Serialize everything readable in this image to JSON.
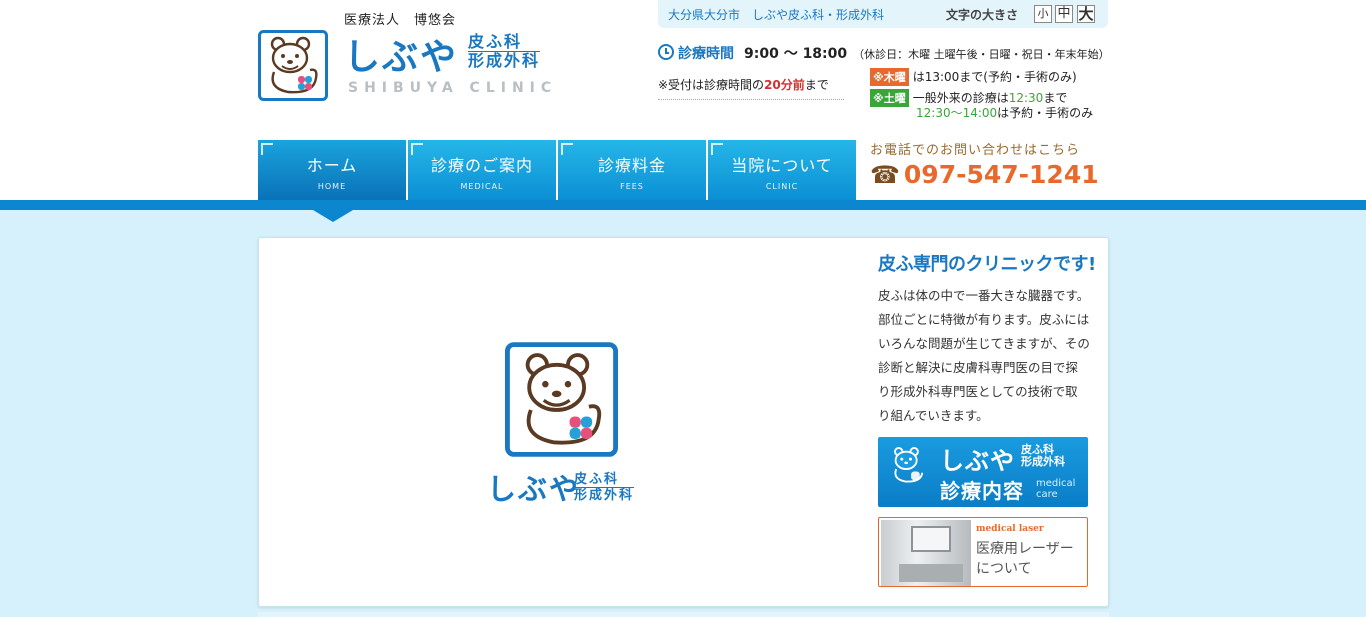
{
  "header": {
    "corp_name": "医療法人　博悠会",
    "logo": {
      "name": "しぶや",
      "dept_line1": "皮ふ科",
      "dept_line2": "形成外科",
      "english": "SHIBUYA CLINIC"
    },
    "address": "大分県大分市　しぶや皮ふ科・形成外科",
    "font_size": {
      "label": "文字の大きさ",
      "small": "小",
      "medium": "中",
      "large": "大"
    },
    "hours": {
      "label": "診療時間",
      "time": "9:00 〜 18:00",
      "closed": "（休診日：木曜 土曜午後・日曜・祝日・年末年始）",
      "reception_prefix": "※受付は診療時間の",
      "reception_highlight": "20分前",
      "reception_suffix": "まで"
    },
    "notes": {
      "thu_tag": "※木曜",
      "thu_text": "は13:00まで(予約・手術のみ)",
      "sat_tag": "※土曜",
      "sat_text_prefix": "一般外来の診療は",
      "sat_time": "12:30",
      "sat_text_suffix": "まで",
      "sat_line2_time": "12:30〜14:00",
      "sat_line2_text": "は予約・手術のみ"
    },
    "phone": {
      "label": "お電話でのお問い合わせはこちら",
      "icon": "phone-icon",
      "number": "097-547-1241"
    }
  },
  "nav": [
    {
      "jp": "ホーム",
      "en": "HOME"
    },
    {
      "jp": "診療のご案内",
      "en": "MEDICAL"
    },
    {
      "jp": "診療料金",
      "en": "FEES"
    },
    {
      "jp": "当院について",
      "en": "CLINIC"
    }
  ],
  "hero": {
    "name": "しぶや",
    "dept_line1": "皮ふ科",
    "dept_line2": "形成外科"
  },
  "side": {
    "title": "皮ふ専門のクリニックです!",
    "text": "皮ふは体の中で一番大きな臓器です。部位ごとに特徴が有ります。皮ふにはいろんな問題が生じてきますが、その診断と解決に皮膚科専門医の目で探り形成外科専門医としての技術で取り組んでいきます。",
    "banner_medical": {
      "name": "しぶや",
      "dept_line1": "皮ふ科",
      "dept_line2": "形成外科",
      "sub": "診療内容",
      "en_line1": "medical",
      "en_line2": "care"
    },
    "banner_laser": {
      "en": "medical laser",
      "jp_line1": "医療用レーザー",
      "jp_line2": "について"
    }
  },
  "colors": {
    "brand_blue": "#1a78c2",
    "nav_blue": "#0c8fd4",
    "orange": "#e9692d",
    "green": "#3aa63a",
    "bg": "#d6f1fb"
  }
}
